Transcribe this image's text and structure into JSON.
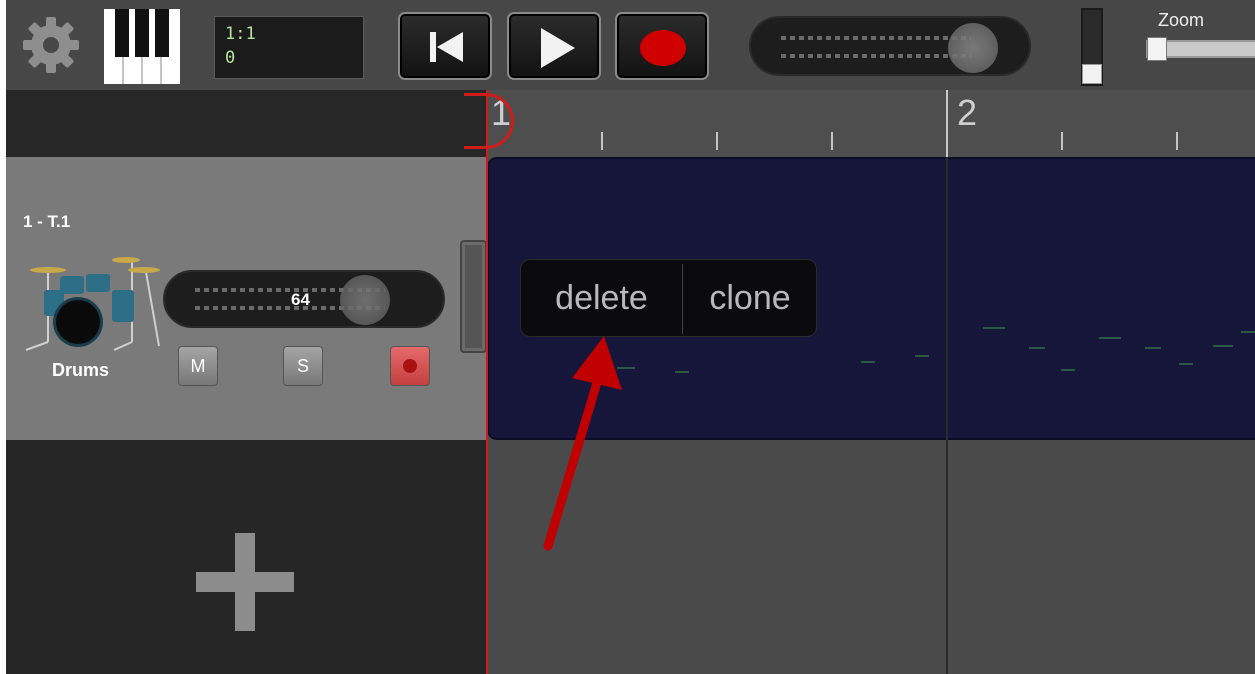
{
  "toolbar": {
    "settings_icon": "gear-icon",
    "keyboard_icon": "piano-keys-icon",
    "position_bar": "1:1",
    "position_tick": "0",
    "zoom_label": "Zoom"
  },
  "track": {
    "title": "1 - T.1",
    "instrument_icon": "drum-kit-icon",
    "name": "Drums",
    "volume_value": "64",
    "mute_label": "M",
    "solo_label": "S"
  },
  "timeline": {
    "bar_labels": [
      "1",
      "2"
    ]
  },
  "context_menu": {
    "delete_label": "delete",
    "clone_label": "clone"
  },
  "colors": {
    "region_bg": "#16163a",
    "playhead": "#d11b1b",
    "annotation_arrow": "#c00000"
  }
}
